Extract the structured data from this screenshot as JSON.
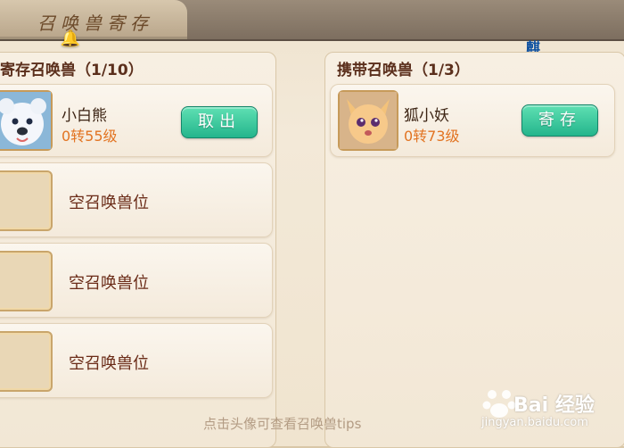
{
  "header": {
    "title": "召唤兽寄存",
    "corner_glyph": "麒"
  },
  "left_panel": {
    "title": "寄存召唤兽（1/10）",
    "pet": {
      "name": "小白熊",
      "level": "0转55级",
      "action": "取出",
      "avatar": "white-bear-avatar"
    },
    "empty_slots": [
      "空召唤兽位",
      "空召唤兽位",
      "空召唤兽位"
    ]
  },
  "right_panel": {
    "title": "携带召唤兽（1/3）",
    "pet": {
      "name": "狐小妖",
      "level": "0转73级",
      "action": "寄存",
      "avatar": "fox-avatar"
    }
  },
  "footer": {
    "tips": "点击头像可查看召唤兽tips"
  },
  "watermark": {
    "brand": "Bai 经验",
    "url": "jingyan.baidu.com"
  },
  "colors": {
    "button": "#24b58c",
    "level": "#e27422",
    "title": "#5b2f1c"
  }
}
